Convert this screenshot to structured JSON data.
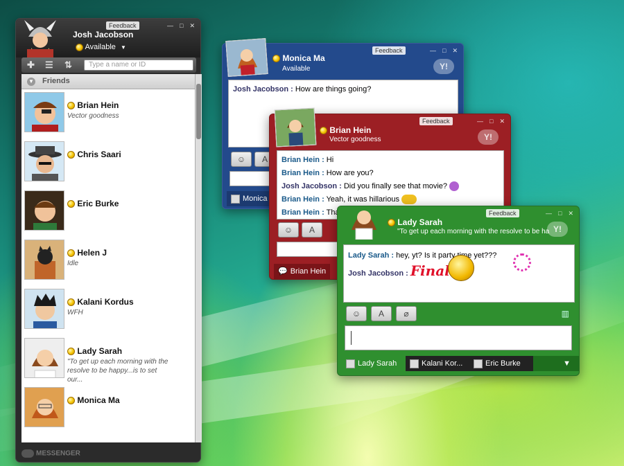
{
  "main": {
    "user_name": "Josh Jacobson",
    "status": "Available",
    "feedback_label": "Feedback",
    "search_placeholder": "Type a name or ID",
    "group_label": "Friends",
    "footer_label": "MESSENGER",
    "contacts": [
      {
        "name": "Brian Hein",
        "sub": "Vector goodness"
      },
      {
        "name": "Chris Saari",
        "sub": ""
      },
      {
        "name": "Eric Burke",
        "sub": ""
      },
      {
        "name": "Helen J",
        "sub": "Idle"
      },
      {
        "name": "Kalani Kordus",
        "sub": "WFH"
      },
      {
        "name": "Lady Sarah",
        "sub": "\"To get up each morning with the resolve to be happy...is to set our..."
      },
      {
        "name": "Monica Ma",
        "sub": ""
      }
    ]
  },
  "monica": {
    "title": "Monica Ma",
    "status": "Available",
    "feedback_label": "Feedback",
    "messages": [
      {
        "from": "Josh Jacobson :",
        "text": "How are things going?"
      }
    ],
    "tab_label": "Monica"
  },
  "brian": {
    "title": "Brian Hein",
    "status": "Vector goodness",
    "feedback_label": "Feedback",
    "messages": [
      {
        "from": "Brian Hein :",
        "text": "Hi"
      },
      {
        "from": "Brian Hein :",
        "text": "How are you?"
      },
      {
        "from": "Josh Jacobson :",
        "text": "Did you finally see that movie?"
      },
      {
        "from": "Brian Hein :",
        "text": "Yeah, it was hillarious"
      },
      {
        "from": "Brian Hein :",
        "text": "That"
      }
    ],
    "tab_label": "Brian Hein"
  },
  "sarah": {
    "title": "Lady Sarah",
    "status": "\"To get up each morning with the resolve to be ha",
    "feedback_label": "Feedback",
    "messages": [
      {
        "from": "Lady Sarah :",
        "text": "hey, yt? Is it party time yet???"
      },
      {
        "from": "Josh Jacobson :",
        "text": "Finally"
      }
    ],
    "tabs": [
      "Lady Sarah",
      "Kalani Kor...",
      "Eric Burke"
    ]
  },
  "colors": {
    "monica_frame": "#234a8c",
    "brian_frame": "#9c1f24",
    "sarah_frame": "#2f8f2f",
    "list_frame": "#2b2b2b"
  }
}
